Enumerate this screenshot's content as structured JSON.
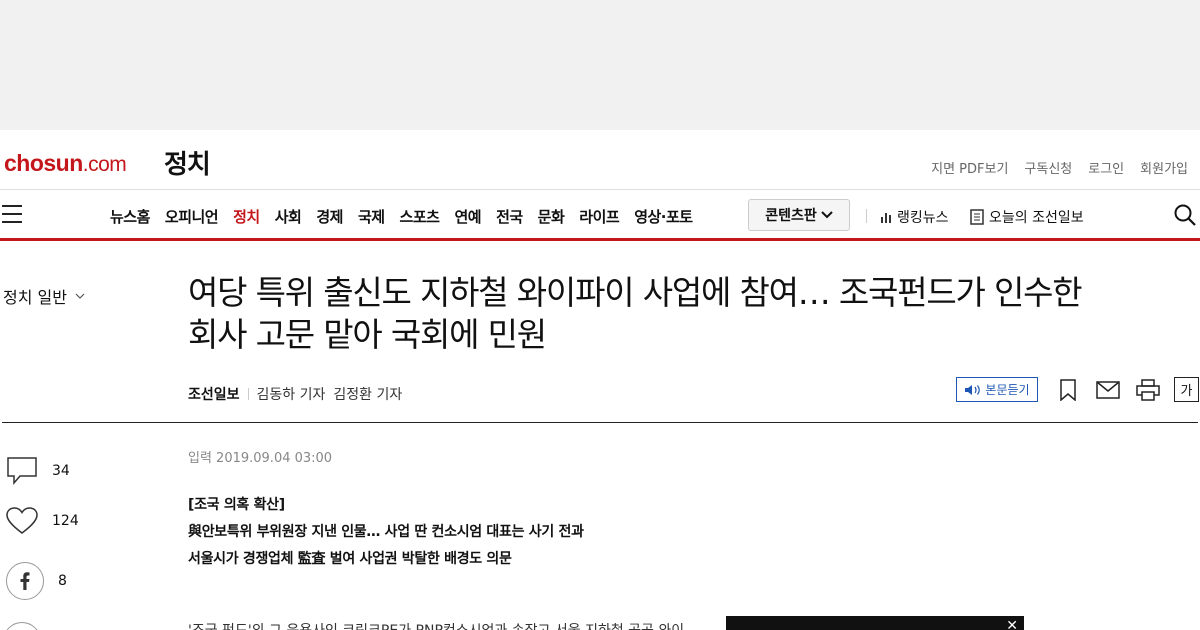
{
  "masthead": {
    "logo_main": "chosun",
    "logo_suffix": ".com",
    "section": "정치",
    "util_links": [
      "지면 PDF보기",
      "구독신청",
      "로그인",
      "회원가입"
    ]
  },
  "nav": {
    "items": [
      "뉴스홈",
      "오피니언",
      "정치",
      "사회",
      "경제",
      "국제",
      "스포츠",
      "연예",
      "전국",
      "문화",
      "라이프",
      "영상·포토"
    ],
    "active_index": 2,
    "content_button": "콘텐츠판",
    "ranking": "랭킹뉴스",
    "today_paper": "오늘의 조선일보"
  },
  "sidebar": {
    "category": "정치 일반"
  },
  "article": {
    "headline_line1": "여당 특위 출신도 지하철 와이파이 사업에 참여… 조국펀드가 인수한",
    "headline_line2": "회사 고문 맡아 국회에 민원",
    "org": "조선일보",
    "authors": [
      "김동하 기자",
      "김정환 기자"
    ],
    "listen_label": "본문듣기",
    "font_label": "가",
    "date": "입력 2019.09.04 03:00",
    "subheads": [
      "[조국 의혹 확산]",
      "與안보특위 부위원장 지낸 인물… 사업 딴 컨소시엄 대표는 사기 전과",
      "서울시가 경쟁업체 監査 벌여 사업권 박탈한 배경도 의문"
    ],
    "body_first_line": "'조국 펀드'의 그 운용사인 코링크PE가 PNP컨소시엄과 손잡고 서울 지하철 공공 와이"
  },
  "social": {
    "comments": "34",
    "likes": "124",
    "facebook": "8"
  },
  "colors": {
    "brand_red": "#c3171c",
    "listen_blue": "#1e57b5"
  }
}
